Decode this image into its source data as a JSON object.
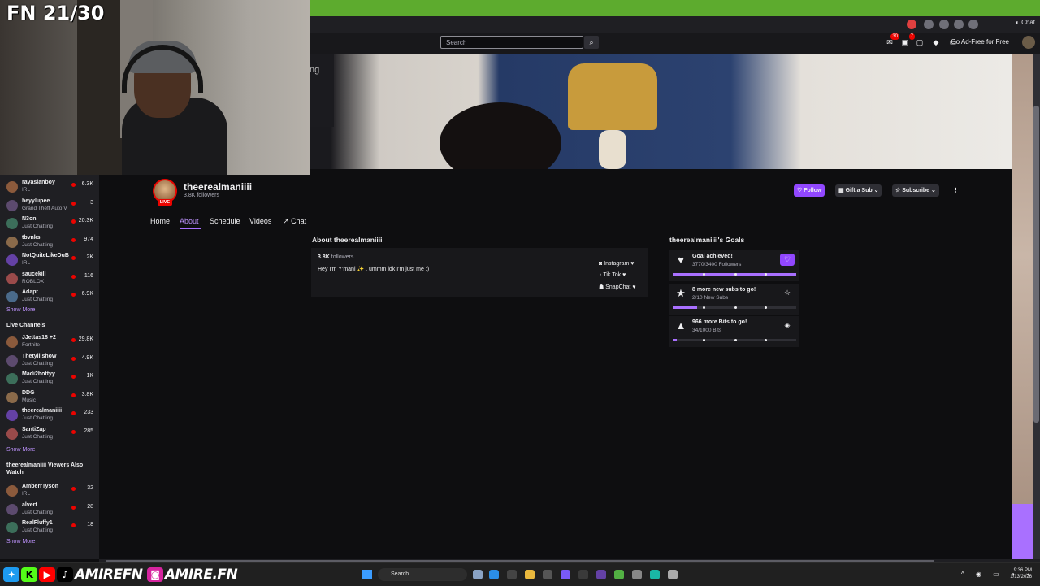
{
  "overlay": {
    "fn_counter": "FN 21/30",
    "socials_handle_1": "AMIREFN",
    "socials_handle_2": "AMIRE.FN"
  },
  "browser": {
    "search_placeholder": "Search",
    "chat_label": "Chat",
    "ad_free_label": "Go Ad-Free for Free",
    "notif_badge_1": "30",
    "notif_badge_2": "7"
  },
  "banner": {
    "text_fragment": "ng"
  },
  "channel": {
    "name": "theerealmaniiii",
    "followers": "3.8K followers",
    "live_badge": "LIVE",
    "tabs": [
      "Home",
      "About",
      "Schedule",
      "Videos",
      "Chat"
    ],
    "active_tab": "About",
    "actions": {
      "follow": "Follow",
      "gift": "Gift a Sub",
      "subscribe": "Subscribe"
    }
  },
  "about": {
    "title": "About theerealmaniiii",
    "followers_count": "3.8K",
    "followers_word": "followers",
    "bio": "Hey I'm Y'mani ✨ , ummm idk I'm just me ;)",
    "socials": [
      "Instagram",
      "Tik Tok",
      "SnapChat"
    ]
  },
  "goals": {
    "title": "theerealmaniiii's Goals",
    "items": [
      {
        "title": "Goal achieved!",
        "sub": "3770/3400 Followers",
        "progress": 1.0,
        "icon": "heart-icon"
      },
      {
        "title": "8 more new subs to go!",
        "sub": "2/10 New Subs",
        "progress": 0.2,
        "icon": "star-icon"
      },
      {
        "title": "966 more Bits to go!",
        "sub": "34/1000 Bits",
        "progress": 0.034,
        "icon": "bits-icon"
      }
    ]
  },
  "sidebar": {
    "followed": [
      {
        "name": "rayasianboy",
        "game": "IRL",
        "count": "6.3K"
      },
      {
        "name": "heyylupee",
        "game": "Grand Theft Auto V",
        "count": "3"
      },
      {
        "name": "N3on",
        "game": "Just Chatting",
        "count": "20.3K"
      },
      {
        "name": "tbvnks",
        "game": "Just Chatting",
        "count": "974"
      },
      {
        "name": "NotQuiteLikeDuB",
        "game": "IRL",
        "count": "2K"
      },
      {
        "name": "saucekill",
        "game": "ROBLOX",
        "count": "116"
      },
      {
        "name": "Adapt",
        "game": "Just Chatting",
        "count": "6.9K"
      }
    ],
    "show_more_1": "Show More",
    "live_header": "Live Channels",
    "live": [
      {
        "name": "JJettas18 +2",
        "game": "Fortnite",
        "count": "29.8K"
      },
      {
        "name": "Thetyllishow",
        "game": "Just Chatting",
        "count": "4.9K"
      },
      {
        "name": "Madi2hottyy",
        "game": "Just Chatting",
        "count": "1K"
      },
      {
        "name": "DDG",
        "game": "Music",
        "count": "3.8K"
      },
      {
        "name": "theerealmaniiii",
        "game": "Just Chatting",
        "count": "233"
      },
      {
        "name": "SantiZap",
        "game": "Just Chatting",
        "count": "285"
      }
    ],
    "show_more_2": "Show More",
    "also_watch_header_1": "theerealmaniiii Viewers Also",
    "also_watch_header_2": "Watch",
    "also_watch": [
      {
        "name": "AmberrTyson",
        "game": "IRL",
        "count": "32"
      },
      {
        "name": "alvert",
        "game": "Just Chatting",
        "count": "28"
      },
      {
        "name": "RealFluffy1",
        "game": "Just Chatting",
        "count": "18"
      }
    ],
    "show_more_3": "Show More"
  },
  "taskbar": {
    "search": "Search",
    "time": "9:36 PM",
    "date": "1/13/2026"
  },
  "colors": {
    "accent": "#a970ff",
    "live": "#eb0400",
    "bg": "#0e0e10"
  }
}
